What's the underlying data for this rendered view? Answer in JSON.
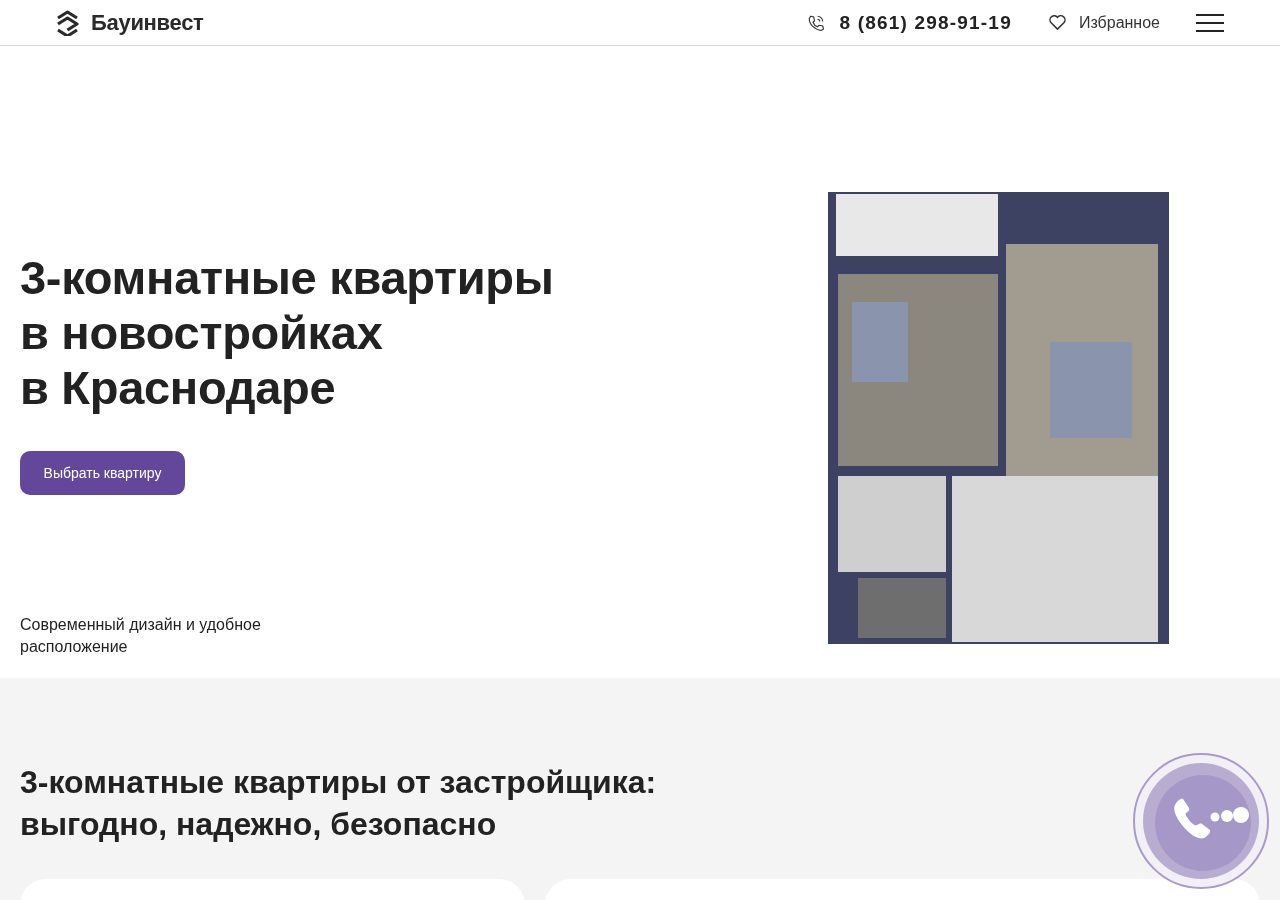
{
  "header": {
    "logo": "Бауинвест",
    "phone": "8 (861) 298-91-19",
    "favorites": "Избранное"
  },
  "hero": {
    "title_lines": [
      "3-комнатные квартиры",
      "в новостройках",
      "в Краснодаре"
    ],
    "button": "Выбрать квартиру",
    "subtitle": "Современный дизайн и удобное расположение"
  },
  "benefits": {
    "title_lines": [
      "3-комнатные квартиры от застройщика:",
      "выгодно, надежно, безопасно"
    ]
  }
}
